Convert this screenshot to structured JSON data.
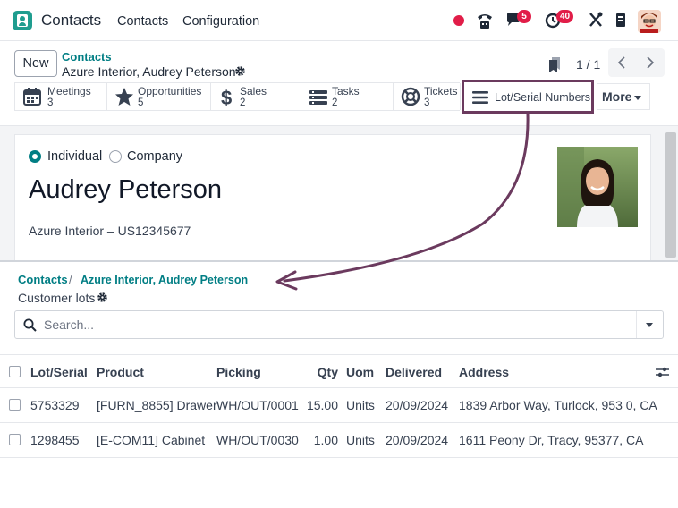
{
  "nav": {
    "app_title": "Contacts",
    "menu": [
      "Contacts",
      "Configuration"
    ],
    "chat_badge": "5",
    "activity_badge": "40"
  },
  "control": {
    "new_label": "New",
    "breadcrumb_parent": "Contacts",
    "breadcrumb_record": "Azure Interior, Audrey Peterson",
    "pager": "1 / 1"
  },
  "smart_buttons": [
    {
      "label": "Meetings",
      "count": "3"
    },
    {
      "label": "Opportunities",
      "count": "5"
    },
    {
      "label": "Sales",
      "count": "2"
    },
    {
      "label": "Tasks",
      "count": "2"
    },
    {
      "label": "Tickets",
      "count": "3"
    }
  ],
  "lot_button": {
    "label": "Lot/Serial Numbers"
  },
  "more_button": {
    "label": "More"
  },
  "form": {
    "type_individual": "Individual",
    "type_company": "Company",
    "name": "Audrey Peterson",
    "company_line": "Azure Interior – US12345677"
  },
  "lots": {
    "breadcrumb_parent": "Contacts",
    "breadcrumb_sep": "/",
    "breadcrumb_record": "Azure Interior, Audrey Peterson",
    "title": "Customer lots",
    "search_placeholder": "Search...",
    "columns": [
      "Lot/Serial",
      "Product",
      "Picking",
      "Qty",
      "Uom",
      "Delivered",
      "Address"
    ],
    "rows": [
      [
        "5753329",
        "[FURN_8855] Drawer",
        "WH/OUT/0001",
        "15.00",
        "Units",
        "20/09/2024",
        "1839 Arbor Way, Turlock, 953  0, CA"
      ],
      [
        "1298455",
        "[E-COM11] Cabinet",
        "WH/OUT/0030",
        "1.00",
        "Units",
        "20/09/2024",
        "1611 Peony Dr, Tracy, 95377, CA"
      ]
    ]
  },
  "colors": {
    "accent": "#017e84",
    "highlight_border": "#6b3a5e",
    "badge": "#e11d48"
  }
}
